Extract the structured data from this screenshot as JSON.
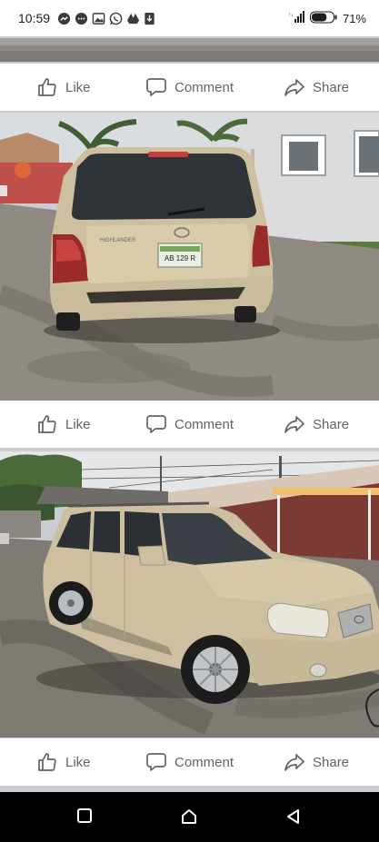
{
  "status_bar": {
    "time": "10:59",
    "battery_percent": "71%",
    "battery_level": 0.71,
    "notification_icons": [
      "messenger-icon",
      "chat-icon",
      "gallery-icon",
      "whatsapp-icon",
      "drive-icon",
      "download-icon"
    ]
  },
  "posts": [
    {
      "actions": {
        "like": "Like",
        "comment": "Comment",
        "share": "Share"
      }
    },
    {
      "actions": {
        "like": "Like",
        "comment": "Comment",
        "share": "Share"
      }
    },
    {
      "actions": {
        "like": "Like",
        "comment": "Comment",
        "share": "Share"
      }
    }
  ],
  "photos": [
    {
      "subject": "Partially visible photo (top cropped)"
    },
    {
      "subject": "Gold Toyota Highlander SUV, rear view",
      "plate": "AB 129 R",
      "model_badge": "HIGHLANDER"
    },
    {
      "subject": "Gold Toyota Highlander SUV, front three-quarter view"
    }
  ],
  "colors": {
    "feed_background": "#c9ccd1",
    "action_text": "#5f6368",
    "car_body": "#cdbf9f",
    "nav_bar": "#000000"
  }
}
